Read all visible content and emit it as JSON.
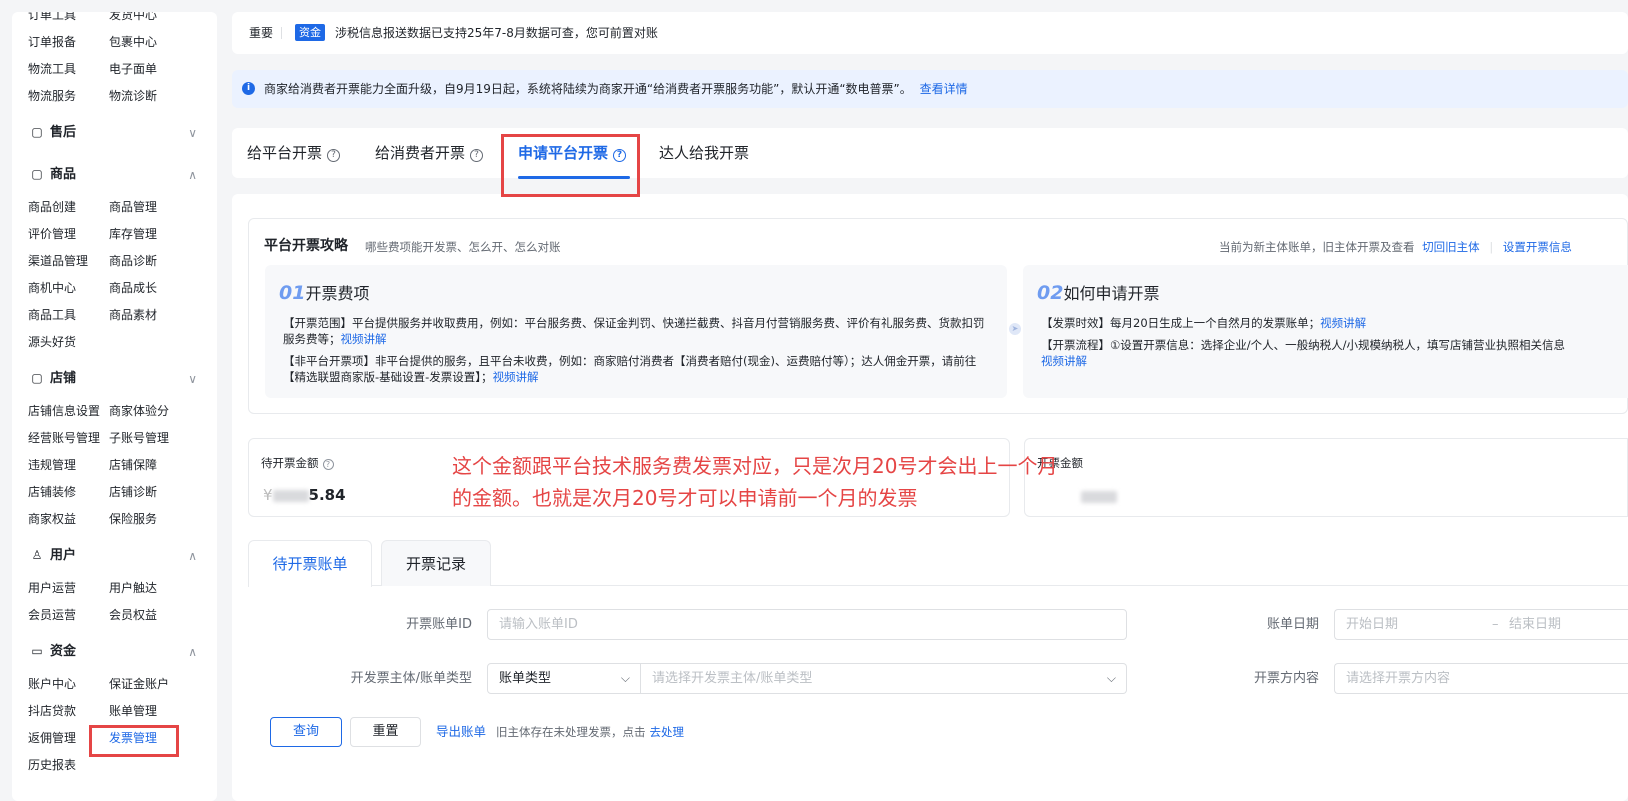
{
  "sidebar": {
    "rows": [
      {
        "left": "订单工具",
        "right": "发货中心"
      },
      {
        "left": "订单报备",
        "right": "包裹中心"
      },
      {
        "left": "物流工具",
        "right": "电子面单"
      },
      {
        "left": "物流服务",
        "right": "物流诊断"
      }
    ],
    "groups": [
      {
        "title": "售后",
        "icon": "clipboard-icon",
        "chevron": "∨",
        "items": []
      },
      {
        "title": "商品",
        "icon": "bag-icon",
        "chevron": "∧",
        "items": [
          {
            "left": "商品创建",
            "right": "商品管理"
          },
          {
            "left": "评价管理",
            "right": "库存管理"
          },
          {
            "left": "渠道品管理",
            "right": "商品诊断"
          },
          {
            "left": "商机中心",
            "right": "商品成长"
          },
          {
            "left": "商品工具",
            "right": "商品素材"
          },
          {
            "left": "源头好货",
            "right": ""
          }
        ]
      },
      {
        "title": "店铺",
        "icon": "store-icon",
        "chevron": "∨",
        "items": [
          {
            "left": "店铺信息设置",
            "right": "商家体验分"
          },
          {
            "left": "经营账号管理",
            "right": "子账号管理"
          },
          {
            "left": "违规管理",
            "right": "店铺保障"
          },
          {
            "left": "店铺装修",
            "right": "店铺诊断"
          },
          {
            "left": "商家权益",
            "right": "保险服务"
          }
        ]
      },
      {
        "title": "用户",
        "icon": "user-icon",
        "chevron": "∧",
        "items": [
          {
            "left": "用户运营",
            "right": "用户触达"
          },
          {
            "left": "会员运营",
            "right": "会员权益"
          }
        ]
      },
      {
        "title": "资金",
        "icon": "wallet-icon",
        "chevron": "∧",
        "items": [
          {
            "left": "账户中心",
            "right": "保证金账户"
          },
          {
            "left": "抖店贷款",
            "right": "账单管理"
          },
          {
            "left": "返佣管理",
            "right": "发票管理"
          },
          {
            "left": "历史报表",
            "right": ""
          }
        ]
      }
    ]
  },
  "notice": {
    "label": "重要",
    "tag": "资金",
    "text": "涉税信息报送数据已支持25年7-8月数据可查，您可前置对账"
  },
  "info_banner": {
    "text": "商家给消费者开票能力全面升级，自9月19日起，系统将陆续为商家开通“给消费者开票服务功能”，默认开通“数电普票”。",
    "link": "查看详情"
  },
  "tabs": [
    {
      "label": "给平台开票",
      "help": "?"
    },
    {
      "label": "给消费者开票",
      "help": "?"
    },
    {
      "label": "申请平台开票",
      "help": "?"
    },
    {
      "label": "达人给我开票",
      "help": ""
    }
  ],
  "guide": {
    "title": "平台开票攻略",
    "subtitle": "哪些费项能开发票、怎么开、怎么对账",
    "right_text": "当前为新主体账单，旧主体开票及查看",
    "right_link1": "切回旧主体",
    "right_link2": "设置开票信息",
    "card1": {
      "num": "01",
      "title": "开票费项",
      "p1": "【开票范围】平台提供服务并收取费用，例如：平台服务费、保证金判罚、快递拦截费、抖音月付营销服务费、评价有礼服务费、货款扣罚服务费等；",
      "p1_link": "视频讲解",
      "p2": "【非平台开票项】非平台提供的服务，且平台未收费，例如：商家赔付消费者【消费者赔付(现金)、运费赔付等）；达人佣金开票，请前往【精选联盟商家版-基础设置-发票设置】；",
      "p2_link": "视频讲解"
    },
    "card2": {
      "num": "02",
      "title": "如何申请开票",
      "p1": "【发票时效】每月20日生成上一个自然月的发票账单；",
      "p1_link": "视频讲解",
      "p2": "【开票流程】①设置开票信息：选择企业/个人、一般纳税人/小规模纳税人，填写店铺营业执照相关信息",
      "p2_link": "视频讲解"
    }
  },
  "amounts": {
    "pending_label": "待开票金额",
    "pending_value_visible": "5.84",
    "pending_prefix": "¥",
    "second_label": "开票金额"
  },
  "annotation": "这个金额跟平台技术服务费发票对应，只是次月20号才会出上一个月的金额。也就是次月20号才可以申请前一个月的发票",
  "bill_tabs": [
    "待开票账单",
    "开票记录"
  ],
  "form": {
    "bill_id_label": "开票账单ID",
    "bill_id_placeholder": "请输入账单ID",
    "date_label": "账单日期",
    "date_start": "开始日期",
    "date_sep": "–",
    "date_end": "结束日期",
    "subject_label": "开发票主体/账单类型",
    "bill_type_value": "账单类型",
    "subject_placeholder": "请选择开发票主体/账单类型",
    "content_label": "开票方内容",
    "content_placeholder": "请选择开票方内容",
    "query_btn": "查询",
    "reset_btn": "重置",
    "export_link": "导出账单",
    "hint": "旧主体存在未处理发票，点击",
    "hint_link": "去处理"
  },
  "colors": {
    "accent": "#1e69e6",
    "annotation": "#e54545"
  }
}
